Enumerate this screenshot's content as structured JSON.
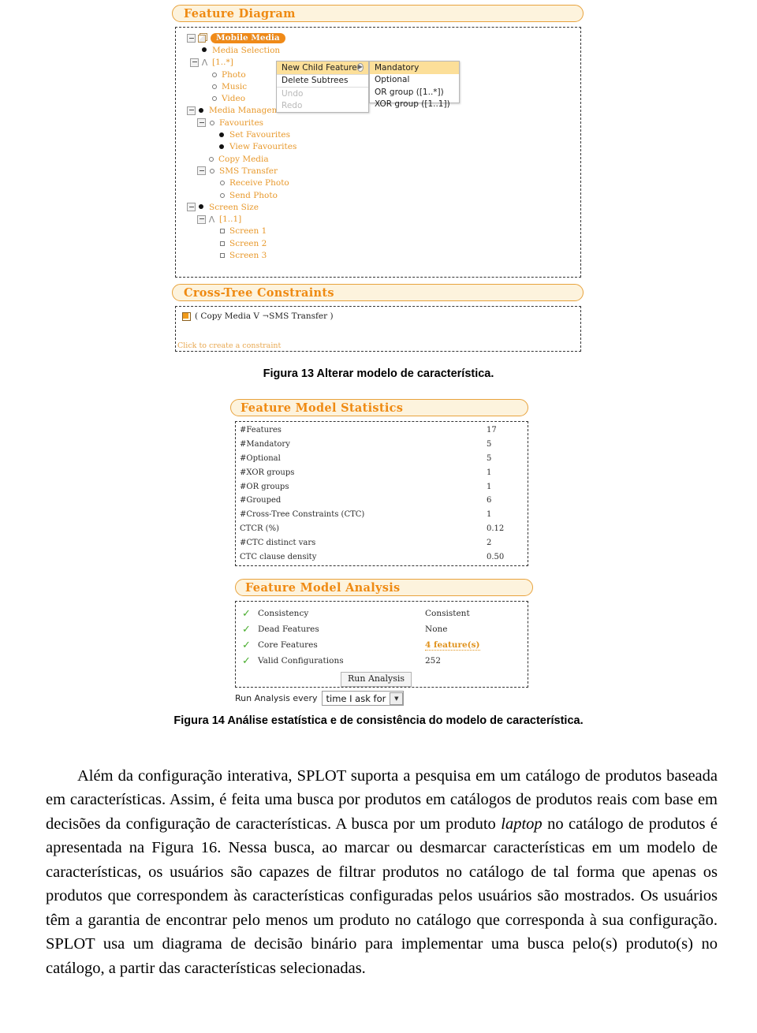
{
  "figure13": {
    "feature_diagram": {
      "header": "Feature Diagram",
      "root": "Mobile Media",
      "nodes": [
        {
          "label": "Media Selection",
          "icon": "filled-bullet",
          "expander": false,
          "indent": 1
        },
        {
          "label": "[1..*]",
          "icon": "or-wedge",
          "expander": true,
          "indent": 1
        },
        {
          "label": "Photo",
          "icon": "hollow-bullet",
          "expander": false,
          "indent": 2
        },
        {
          "label": "Music",
          "icon": "hollow-bullet",
          "expander": false,
          "indent": 2
        },
        {
          "label": "Video",
          "icon": "hollow-bullet",
          "expander": false,
          "indent": 2
        },
        {
          "label": "Media Management",
          "icon": "filled-bullet",
          "expander": true,
          "indent": 0
        },
        {
          "label": "Favourites",
          "icon": "hollow-bullet",
          "expander": true,
          "indent": 1
        },
        {
          "label": "Set Favourites",
          "icon": "filled-bullet",
          "expander": false,
          "indent": 2
        },
        {
          "label": "View Favourites",
          "icon": "filled-bullet",
          "expander": false,
          "indent": 2
        },
        {
          "label": "Copy Media",
          "icon": "hollow-bullet",
          "expander": false,
          "indent": 1
        },
        {
          "label": "SMS Transfer",
          "icon": "hollow-bullet",
          "expander": true,
          "indent": 1
        },
        {
          "label": "Receive Photo",
          "icon": "hollow-bullet",
          "expander": false,
          "indent": 2
        },
        {
          "label": "Send Photo",
          "icon": "hollow-bullet",
          "expander": false,
          "indent": 2
        },
        {
          "label": "Screen Size",
          "icon": "filled-bullet",
          "expander": true,
          "indent": 0
        },
        {
          "label": "[1..1]",
          "icon": "xor-wedge",
          "expander": true,
          "indent": 1
        },
        {
          "label": "Screen 1",
          "icon": "square-bullet",
          "expander": false,
          "indent": 2
        },
        {
          "label": "Screen 2",
          "icon": "square-bullet",
          "expander": false,
          "indent": 2
        },
        {
          "label": "Screen 3",
          "icon": "square-bullet",
          "expander": false,
          "indent": 2
        }
      ]
    },
    "context_menu": {
      "items": [
        {
          "label": "New Child Feature",
          "submenu": true,
          "disabled": false,
          "highlighted": true
        },
        {
          "label": "Delete Subtrees",
          "submenu": false,
          "disabled": false,
          "highlighted": false
        },
        {
          "label": "Undo",
          "submenu": false,
          "disabled": true,
          "highlighted": false
        },
        {
          "label": "Redo",
          "submenu": false,
          "disabled": true,
          "highlighted": false
        }
      ],
      "submenu_items": [
        {
          "label": "Mandatory",
          "highlighted": true
        },
        {
          "label": "Optional",
          "highlighted": false
        },
        {
          "label": "OR group ([1..*])",
          "highlighted": false
        },
        {
          "label": "XOR group ([1..1])",
          "highlighted": false
        }
      ]
    },
    "cross_tree": {
      "header": "Cross-Tree Constraints",
      "constraint": "( Copy Media  V  ¬SMS Transfer )",
      "hint": "Click to create a constraint"
    },
    "caption": "Figura 13 Alterar modelo de característica."
  },
  "figure14": {
    "statistics": {
      "header": "Feature Model Statistics",
      "rows": [
        {
          "label": "#Features",
          "value": "17"
        },
        {
          "label": "#Mandatory",
          "value": "5"
        },
        {
          "label": "#Optional",
          "value": "5"
        },
        {
          "label": "#XOR groups",
          "value": "1"
        },
        {
          "label": "#OR groups",
          "value": "1"
        },
        {
          "label": "#Grouped",
          "value": "6"
        },
        {
          "label": "#Cross-Tree Constraints (CTC)",
          "value": "1"
        },
        {
          "label": "CTCR (%)",
          "value": "0.12"
        },
        {
          "label": "#CTC distinct vars",
          "value": "2"
        },
        {
          "label": "CTC clause density",
          "value": "0.50"
        }
      ]
    },
    "analysis": {
      "header": "Feature Model Analysis",
      "rows": [
        {
          "label": "Consistency",
          "value": "Consistent",
          "link": false,
          "status": "ok"
        },
        {
          "label": "Dead Features",
          "value": "None",
          "link": false,
          "status": "ok"
        },
        {
          "label": "Core Features",
          "value": "4 feature(s)",
          "link": true,
          "status": "ok"
        },
        {
          "label": "Valid Configurations",
          "value": "252",
          "link": false,
          "status": "ok"
        }
      ],
      "run_button": "Run Analysis",
      "schedule_label": "Run Analysis every",
      "schedule_value": "time I ask for",
      "schedule_options": [
        "time I ask for"
      ]
    },
    "caption": "Figura 14 Análise estatística e de consistência do modelo de característica."
  },
  "body": {
    "para_1": "Além da configuração interativa, SPLOT suporta a pesquisa em um catálogo de produtos baseada em características. Assim, é feita uma busca por produtos em catálogos de produtos reais com base em decisões da configuração de características. A busca por um produto ",
    "para_italic": "laptop",
    "para_2": " no catálogo de produtos é apresentada na Figura 16. Nessa busca, ao marcar ou desmarcar características em um modelo de características, os usuários são capazes de filtrar produtos no catálogo de tal forma que apenas os produtos que correspondem às características configuradas pelos usuários são mostrados. Os usuários têm a garantia de encontrar pelo menos um produto no catálogo que corresponda à sua configuração. SPLOT usa um diagrama de decisão binário para implementar uma busca pelo(s) produto(s) no catálogo, a partir das características selecionadas."
  },
  "colors": {
    "accent_orange": "#ef8a12",
    "panel_cream": "#fdf3dd",
    "highlight_yellow": "#fcdf99",
    "check_green": "#49ad2e"
  }
}
